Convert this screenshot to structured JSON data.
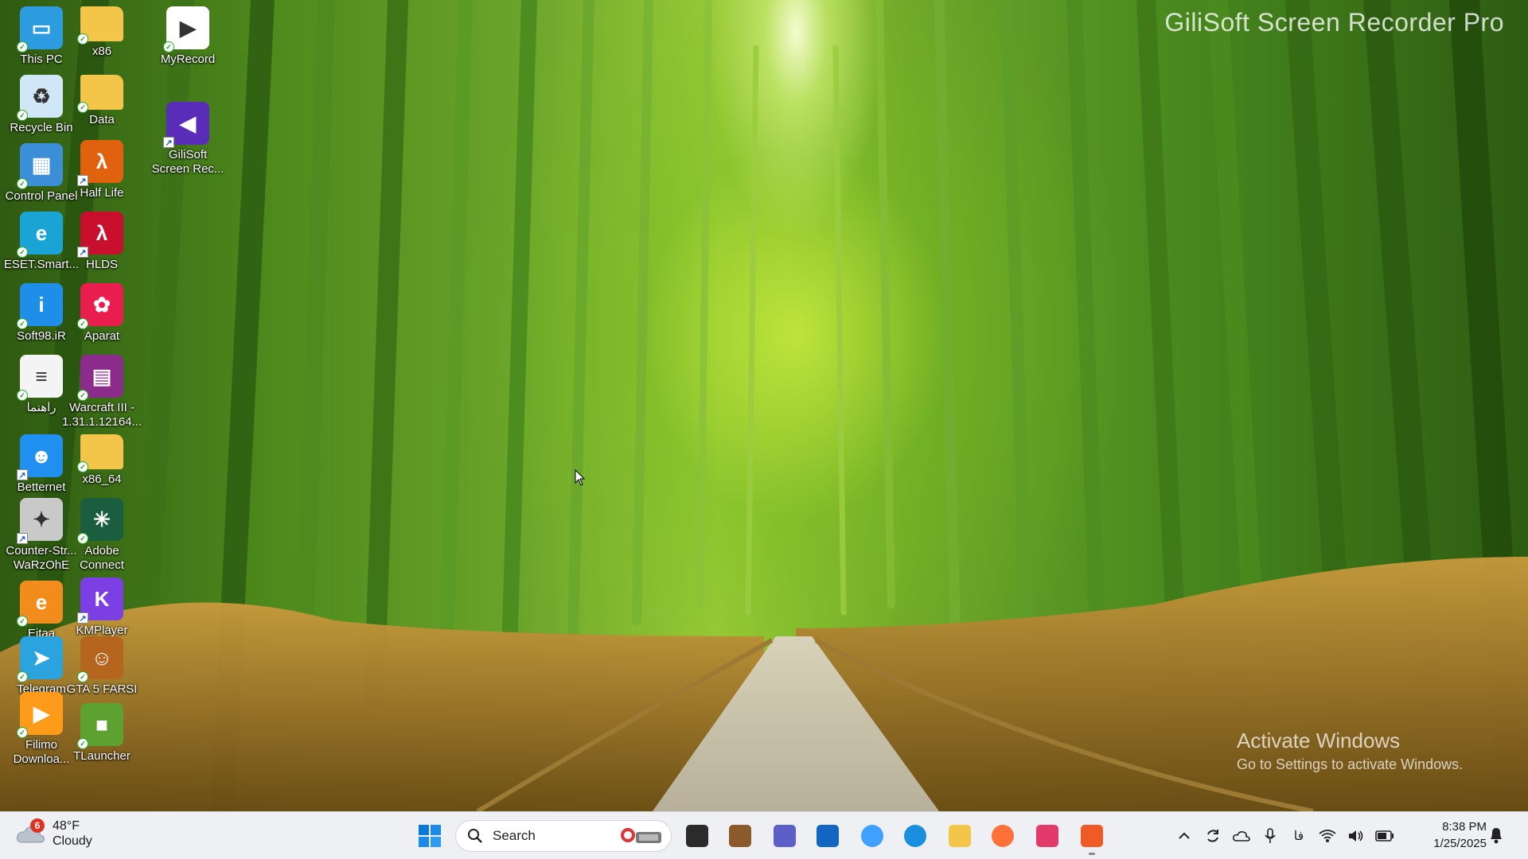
{
  "watermark": {
    "recorder": "GiliSoft Screen Recorder Pro"
  },
  "activation": {
    "title": "Activate Windows",
    "subtitle": "Go to Settings to activate Windows."
  },
  "desktop_icons": [
    {
      "label": "This PC",
      "icon": "this-pc-icon",
      "color": "#2d9be0"
    },
    {
      "label": "x86",
      "icon": "folder-icon",
      "color": "#f3c64a"
    },
    {
      "label": "MyRecord",
      "icon": "media-player-icon",
      "color": "#ffffff"
    },
    {
      "label": "Recycle Bin",
      "icon": "recycle-bin-icon",
      "color": "#cfe7f7"
    },
    {
      "label": "Data",
      "icon": "folder-icon",
      "color": "#f3c64a"
    },
    {
      "label": "GiliSoft\nScreen Rec...",
      "icon": "gilisoft-recorder-icon",
      "color": "#5a2db8"
    },
    {
      "label": "Control Panel",
      "icon": "control-panel-icon",
      "color": "#3a8fd6"
    },
    {
      "label": "Half Life",
      "icon": "half-life-icon",
      "color": "#e0620f"
    },
    {
      "label": "ESET.Smart...",
      "icon": "eset-icon",
      "color": "#1aa4d6"
    },
    {
      "label": "HLDS",
      "icon": "hlds-icon",
      "color": "#c8102e"
    },
    {
      "label": "Soft98.iR",
      "icon": "soft98-icon",
      "color": "#1e8ee8"
    },
    {
      "label": "Aparat",
      "icon": "aparat-icon",
      "color": "#e91e4f"
    },
    {
      "label": "راهنما",
      "icon": "pdf-document-icon",
      "color": "#f4f4f4"
    },
    {
      "label": "Warcraft III -\n1.31.1.12164...",
      "icon": "winrar-archive-icon",
      "color": "#8b2c8c"
    },
    {
      "label": "Betternet",
      "icon": "betternet-icon",
      "color": "#1f8ff0"
    },
    {
      "label": "x86_64",
      "icon": "folder-icon",
      "color": "#f3c64a"
    },
    {
      "label": "Counter-Str...\nWaRzOhE",
      "icon": "counter-strike-icon",
      "color": "#c9c9c9"
    },
    {
      "label": "Adobe\nConnect",
      "icon": "adobe-connect-icon",
      "color": "#1b5e3f"
    },
    {
      "label": "Eitaa",
      "icon": "eitaa-icon",
      "color": "#f28c1c"
    },
    {
      "label": "KMPlayer",
      "icon": "kmplayer-icon",
      "color": "#7b3fe4"
    },
    {
      "label": "Telegram",
      "icon": "telegram-icon",
      "color": "#2aa3df"
    },
    {
      "label": "GTA 5 FARSI",
      "icon": "gta5-icon",
      "color": "#b5651d"
    },
    {
      "label": "Filimo\nDownloa...",
      "icon": "filimo-icon",
      "color": "#ff9b1a"
    },
    {
      "label": "TLauncher",
      "icon": "tlauncher-icon",
      "color": "#5da130"
    }
  ],
  "taskbar": {
    "weather": {
      "temperature": "48°F",
      "condition": "Cloudy",
      "badge": "6"
    },
    "search": {
      "label": "Search"
    },
    "pinned": [
      {
        "name": "task-view",
        "icon": "task-view-icon"
      },
      {
        "name": "gta-app",
        "icon": "gta-app-icon"
      },
      {
        "name": "teams",
        "icon": "teams-icon"
      },
      {
        "name": "store",
        "icon": "microsoft-store-icon"
      },
      {
        "name": "copilot",
        "icon": "copilot-icon"
      },
      {
        "name": "edge",
        "icon": "edge-icon"
      },
      {
        "name": "file-explorer",
        "icon": "file-explorer-icon"
      },
      {
        "name": "firefox",
        "icon": "firefox-icon"
      },
      {
        "name": "snipping",
        "icon": "snipping-tool-icon"
      },
      {
        "name": "gilisoft-recorder",
        "icon": "gilisoft-recorder-icon"
      }
    ],
    "tray": {
      "language": "فا"
    },
    "clock": {
      "time": "8:38 PM",
      "date": "1/25/2025"
    }
  },
  "colors": {
    "taskbar_bg": "#eef0f4",
    "accent": "#0067c0"
  }
}
